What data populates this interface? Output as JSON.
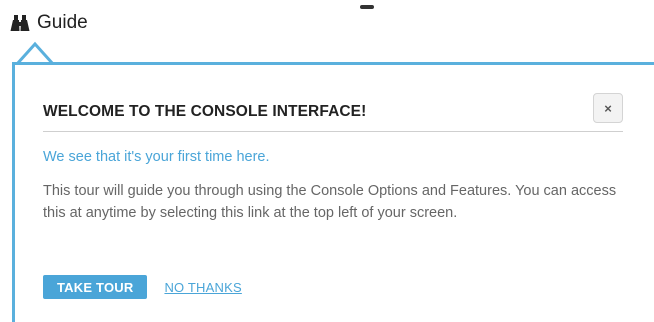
{
  "guide": {
    "label": "Guide",
    "icon": "binoculars-icon"
  },
  "popover": {
    "title": "WELCOME TO THE CONSOLE INTERFACE!",
    "close_label": "×",
    "intro": "We see that it's your first time here.",
    "body": "This tour will guide you through using the Console Options and Features. You can access this at anytime by selecting this link at the top left of your screen.",
    "primary_button": "TAKE TOUR",
    "secondary_link": "NO THANKS"
  },
  "colors": {
    "accent": "#4aa5d8",
    "border": "#5ab0dd",
    "title_text": "#222222",
    "body_text": "#666666"
  }
}
